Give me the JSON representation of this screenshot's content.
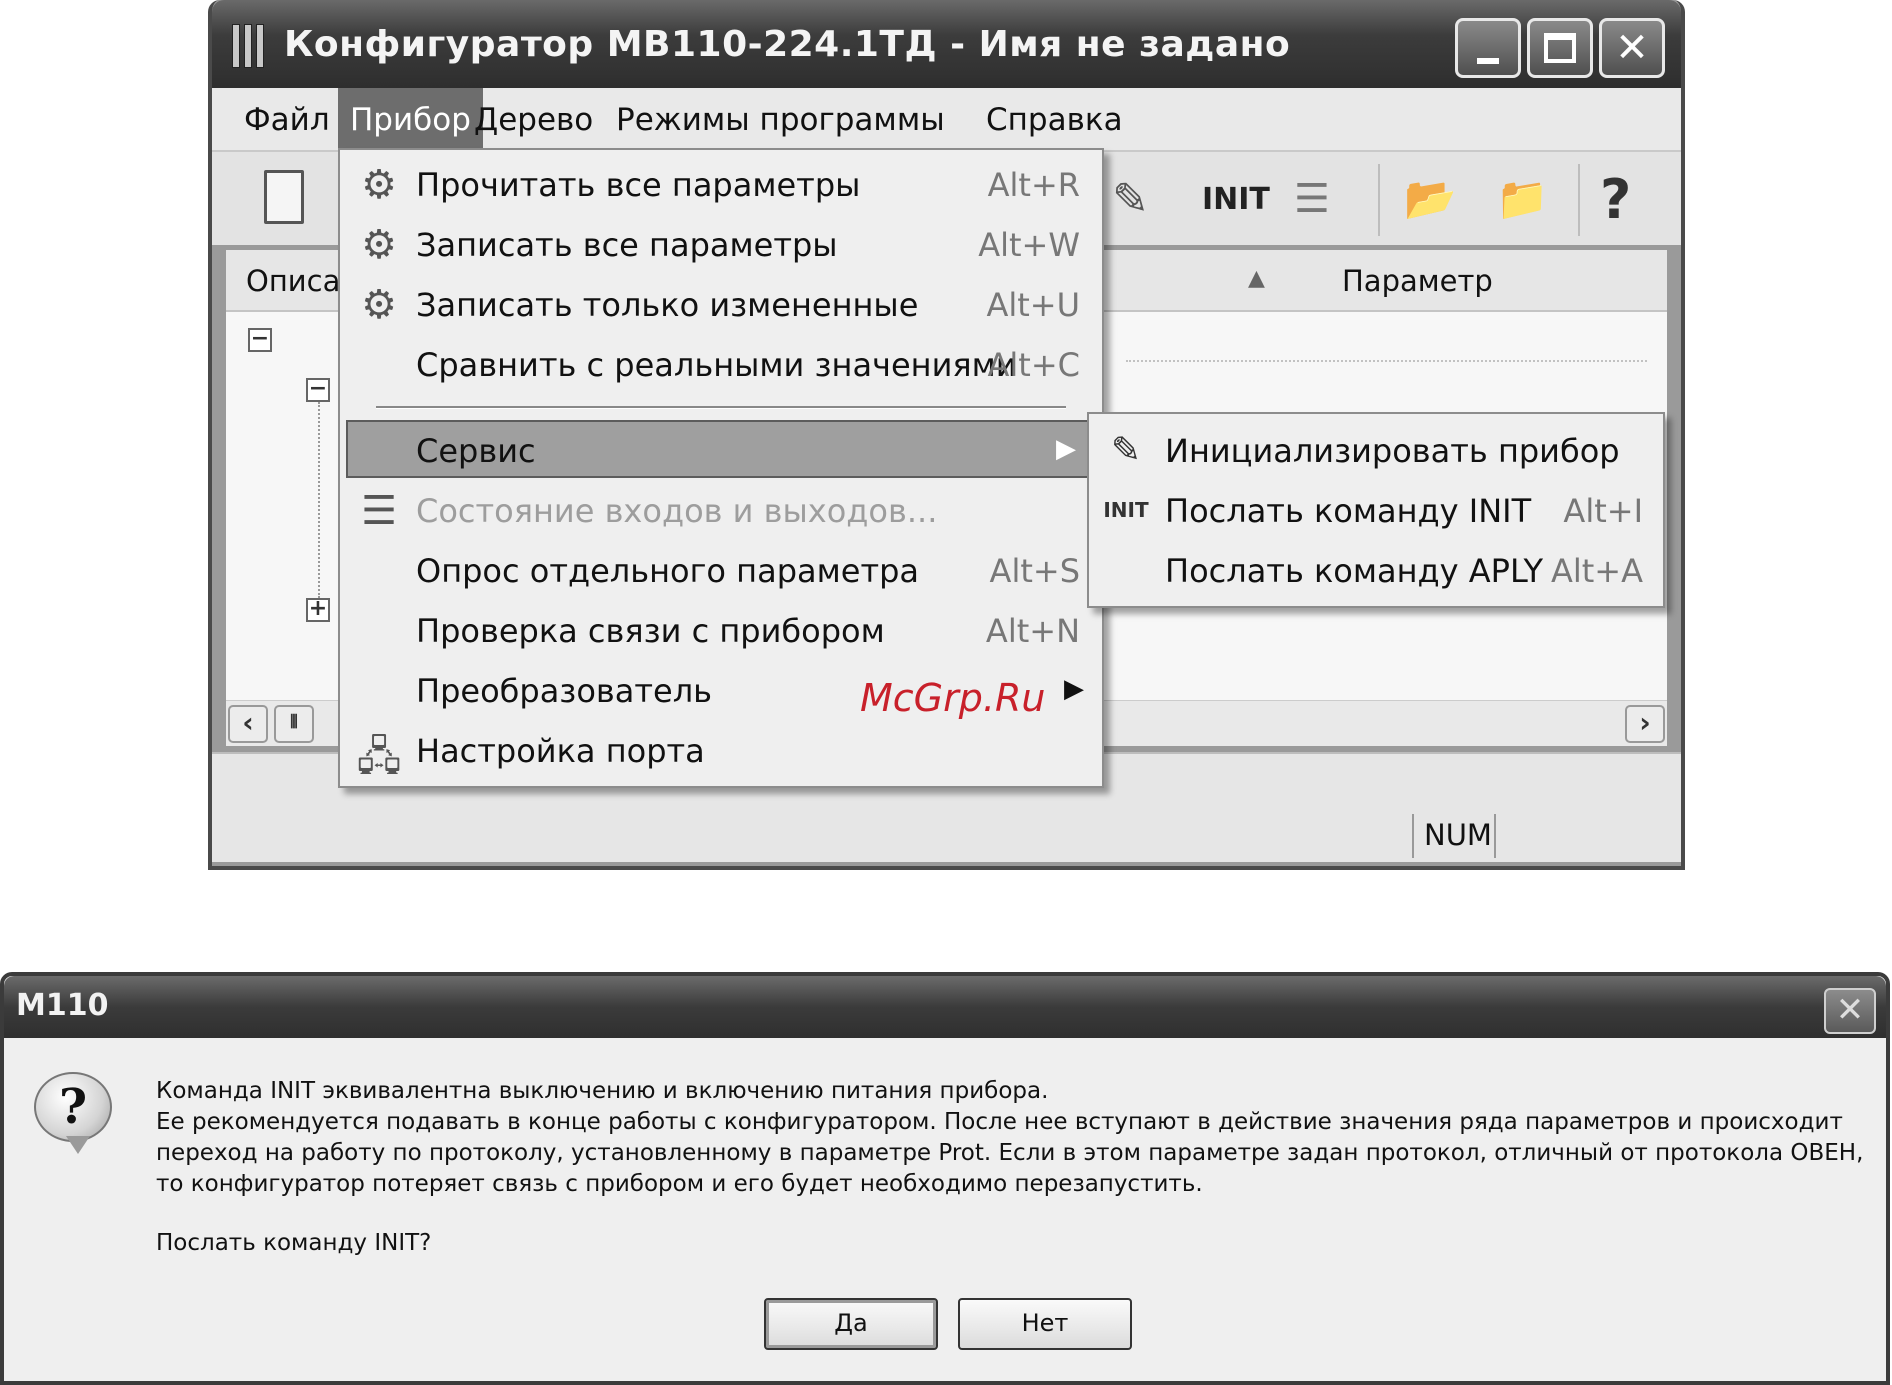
{
  "window": {
    "title": "Конфигуратор МВ110-224.1ТД - Имя не задано",
    "controls": {
      "minimize": "minimize-icon",
      "maximize": "maximize-icon",
      "close": "✕"
    }
  },
  "menubar": [
    "Файл",
    "Прибор",
    "Дерево",
    "Режимы программы",
    "Справка"
  ],
  "toolbar": {
    "init_label": "INIT"
  },
  "columns": {
    "description": "Описа",
    "parameter": "Параметр",
    "sort_arrow": "▲"
  },
  "tree": {
    "minus": "−",
    "plus": "+"
  },
  "scroll": {
    "left": "‹",
    "right": "›",
    "thumb": "⦀"
  },
  "status": {
    "num": "NUM"
  },
  "device_menu": {
    "items": [
      {
        "label": "Прочитать все параметры",
        "shortcut": "Alt+R",
        "icon": "read-icon"
      },
      {
        "label": "Записать все параметры",
        "shortcut": "Alt+W",
        "icon": "write-icon"
      },
      {
        "label": "Записать только измененные",
        "shortcut": "Alt+U",
        "icon": "write-changed-icon"
      },
      {
        "label": "Сравнить с реальными значениями",
        "shortcut": "Alt+C",
        "icon": ""
      },
      {
        "label": "Сервис",
        "shortcut": "",
        "icon": "",
        "submenu": true,
        "selected": true
      },
      {
        "label": "Состояние входов и выходов...",
        "shortcut": "",
        "icon": "io-state-icon",
        "disabled": true
      },
      {
        "label": "Опрос отдельного параметра",
        "shortcut": "Alt+S",
        "icon": ""
      },
      {
        "label": "Проверка связи с прибором",
        "shortcut": "Alt+N",
        "icon": ""
      },
      {
        "label": "Преобразователь",
        "shortcut": "",
        "icon": "",
        "submenu": true
      },
      {
        "label": "Настройка порта",
        "shortcut": "",
        "icon": "port-settings-icon"
      }
    ],
    "submenu_arrow": "▶"
  },
  "service_submenu": {
    "items": [
      {
        "label": "Инициализировать прибор",
        "shortcut": "",
        "icon": "init-device-icon"
      },
      {
        "label": "Послать команду INIT",
        "shortcut": "Alt+I",
        "icon": "INIT"
      },
      {
        "label": "Послать команду APLY",
        "shortcut": "Alt+A",
        "icon": ""
      }
    ]
  },
  "watermark": "McGrp.Ru",
  "dialog": {
    "title": "М110",
    "close": "✕",
    "icon": "?",
    "lines": [
      "Команда INIT эквивалентна выключению и включению питания прибора.",
      "Ее рекомендуется подавать в конце работы с конфигуратором. После нее вступают в действие значения ряда параметров и происходит",
      "переход на работу по протоколу, установленному в параметре Prot. Если в этом параметре задан протокол, отличный от протокола ОВЕН,",
      "то конфигуратор потеряет связь с прибором и его будет необходимо перезапустить."
    ],
    "question": "Послать команду INIT?",
    "yes": "Да",
    "no": "Нет"
  }
}
